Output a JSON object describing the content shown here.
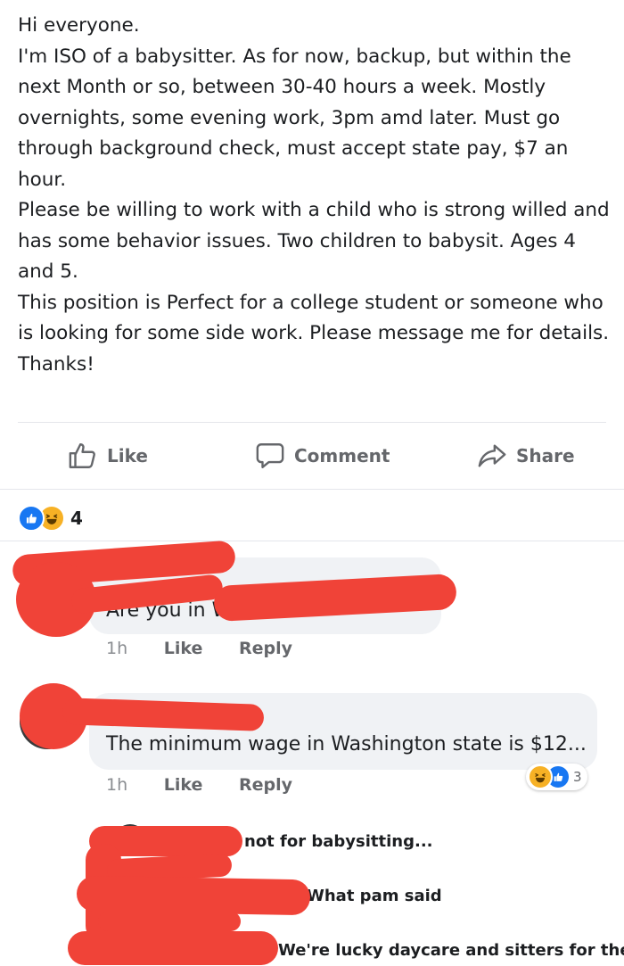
{
  "post": {
    "lines": [
      "Hi everyone.",
      "I'm ISO of a babysitter. As for now, backup, but within the next Month or so, between 30-40 hours a week. Mostly overnights, some evening work, 3pm amd later. Must go through background check, must accept state pay, $7 an hour.",
      "Please be willing to work with a child who is strong willed and has some behavior issues. Two children to babysit. Ages 4 and 5.",
      "This position is Perfect for a college student or someone who is looking for some side work.  Please message me for details.",
      "Thanks!"
    ]
  },
  "actions": {
    "like_label": "Like",
    "comment_label": "Comment",
    "share_label": "Share",
    "like_icon": "thumbs-up-outline-icon",
    "comment_icon": "speech-bubble-icon",
    "share_icon": "share-arrow-icon"
  },
  "reactions": {
    "icons": [
      "like-reaction-icon",
      "haha-reaction-icon"
    ],
    "count": "4"
  },
  "comments": [
    {
      "text": "Are you in W",
      "time": "1h",
      "like_label": "Like",
      "reply_label": "Reply"
    },
    {
      "text": "The minimum wage in Washington state is $12...",
      "time": "1h",
      "like_label": "Like",
      "reply_label": "Reply",
      "reaction_count": "3"
    }
  ],
  "replies": [
    {
      "text": "not for babysitting..."
    },
    {
      "text": "What pam said"
    },
    {
      "text": "We're lucky daycare and sitters for the..."
    }
  ],
  "colors": {
    "like_blue": "#1877f2",
    "haha_yellow": "#f7b125",
    "redaction_red": "#f04338",
    "bubble_gray": "#f0f2f5",
    "meta_gray": "#65676b"
  }
}
